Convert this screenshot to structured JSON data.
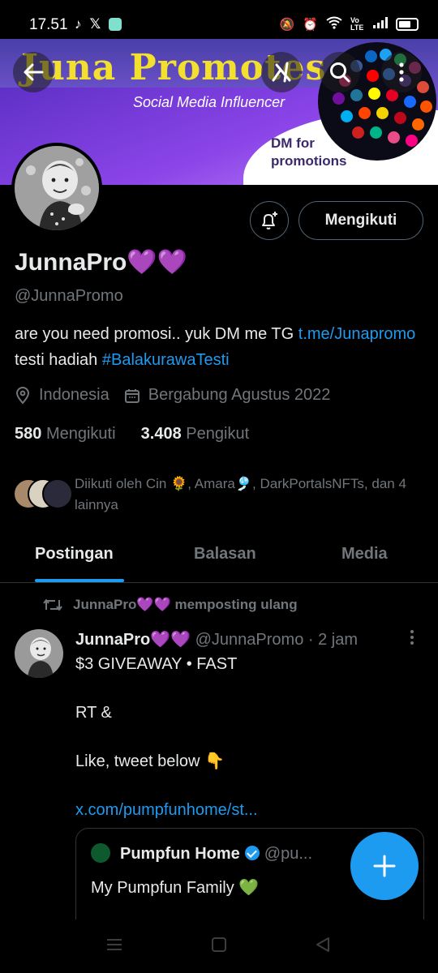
{
  "status_bar": {
    "time": "17.51",
    "left_icons": [
      "tiktok-icon",
      "x-icon",
      "app-icon"
    ],
    "right_icons": [
      "mute-icon",
      "alarm-icon",
      "wifi-icon",
      "volte-icon",
      "signal-icon",
      "battery-icon"
    ],
    "volte_label": "Vo LTE"
  },
  "banner": {
    "title": "Juna Promotes",
    "subtitle": "Social Media Influencer",
    "dm_line1": "DM for",
    "dm_line2": "promotions"
  },
  "header_actions": {
    "back": "back-arrow-icon",
    "grok": "grok-icon",
    "search": "search-icon",
    "more": "more-vertical-icon"
  },
  "profile": {
    "display_name": "JunnaPro💜💜",
    "handle": "@JunnaPromo",
    "bio_text_1": "are you need promosi.. yuk DM me  TG ",
    "bio_link": "t.me/Junapromo",
    "bio_text_2": "  testi hadiah ",
    "bio_hashtag": "#BalakurawaTesti",
    "location": "Indonesia",
    "joined": "Bergabung Agustus 2022",
    "following_count": "580",
    "following_label": "Mengikuti",
    "followers_count": "3.408",
    "followers_label": "Pengikut",
    "followed_by": "Diikuti oleh Cin 🌻, Amara🎐, DarkPortalsNFTs, dan 4 lainnya",
    "follow_button": "Mengikuti"
  },
  "tabs": [
    {
      "label": "Postingan",
      "active": true
    },
    {
      "label": "Balasan",
      "active": false
    },
    {
      "label": "Media",
      "active": false
    }
  ],
  "post": {
    "repost_label": "JunnaPro💜💜 memposting ulang",
    "author_name": "JunnaPro💜💜",
    "author_handle": "@JunnaPromo",
    "time": "· 2 jam",
    "line1": "$3 GIVEAWAY • FAST",
    "line2": "RT &",
    "line3": "Like, tweet below 👇",
    "link": "x.com/pumpfunhome/st...",
    "quote": {
      "name": "Pumpfun Home",
      "handle": "@pu...",
      "text": "My Pumpfun Family 💚"
    }
  },
  "colors": {
    "accent": "#1d9bf0",
    "background": "#000000",
    "text_primary": "#e7e9ea",
    "text_secondary": "#71767b",
    "banner_yellow": "#f2df2e",
    "banner_purple": "#6b2fd1"
  },
  "nav_bar": [
    "menu-icon",
    "home-square-icon",
    "back-triangle-icon"
  ]
}
